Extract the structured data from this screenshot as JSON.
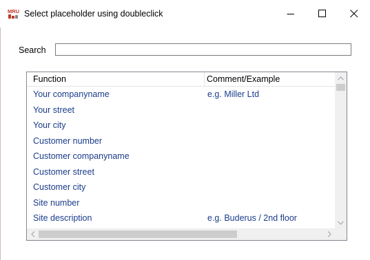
{
  "window": {
    "title": "Select placeholder using doubleclick",
    "app_icon_text": "MRU"
  },
  "search": {
    "label": "Search",
    "value": "",
    "placeholder": ""
  },
  "table": {
    "columns": [
      "Function",
      "Comment/Example"
    ],
    "rows": [
      {
        "function": "Your companyname",
        "comment": "e.g. Miller Ltd"
      },
      {
        "function": "Your street",
        "comment": ""
      },
      {
        "function": "Your city",
        "comment": ""
      },
      {
        "function": "Customer number",
        "comment": ""
      },
      {
        "function": "Customer companyname",
        "comment": ""
      },
      {
        "function": "Customer street",
        "comment": ""
      },
      {
        "function": "Customer city",
        "comment": ""
      },
      {
        "function": "Site number",
        "comment": ""
      },
      {
        "function": "Site description",
        "comment": "e.g. Buderus / 2nd floor"
      }
    ]
  },
  "colors": {
    "row_text": "#1a3c8c",
    "icon_red": "#c0392b"
  }
}
